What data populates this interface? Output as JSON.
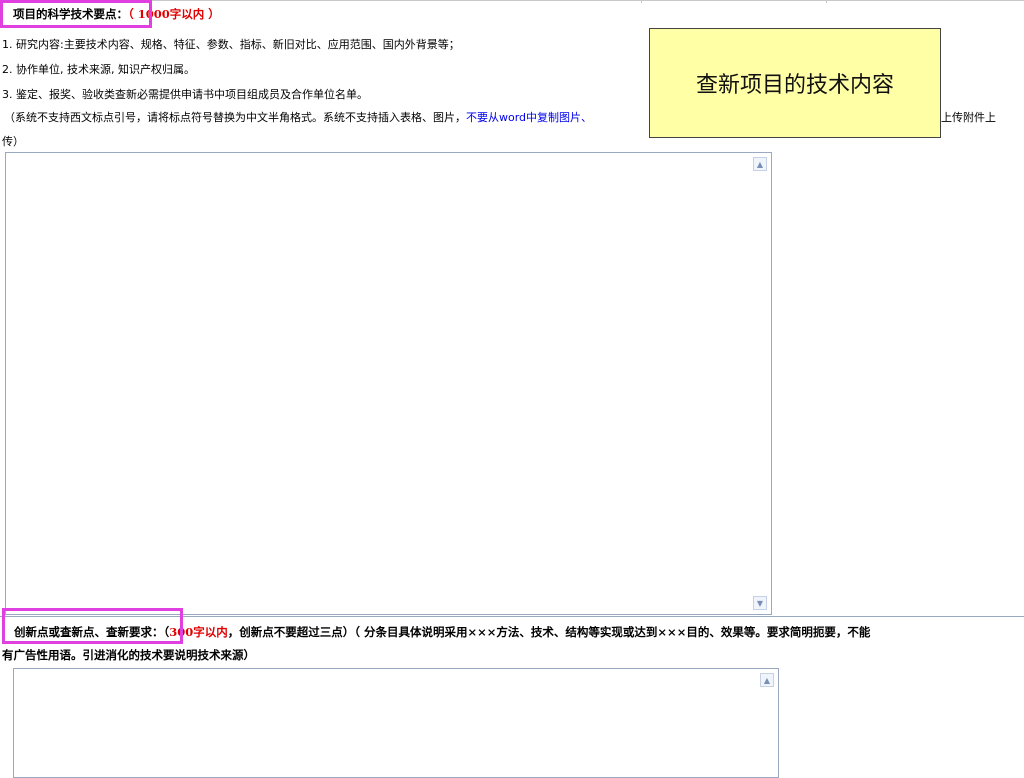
{
  "section1": {
    "title": "项目的科学技术要点：",
    "limit": "（ 1000字以内 ）",
    "items": [
      "1. 研究内容:主要技术内容、规格、特征、参数、指标、新旧对比、应用范围、国内外背景等；",
      "2. 协作单位, 技术来源, 知识产权归属。",
      "3. 鉴定、报奖、验收类查新必需提供申请书中项目组成员及合作单位名单。"
    ],
    "note_prefix": "（系统不支持西文标点引号，请将标点符号替换为中文半角格式。系统不支持插入表格、图片，",
    "note_blue": "不要从word中复制图片、",
    "note_suffix": "上传附件上",
    "note_line2": "传）"
  },
  "tooltip": {
    "text": "查新项目的技术内容",
    "bg": "#ffffa6"
  },
  "section2": {
    "title": "创新点或查新点、查新要求：",
    "limit_open": "（",
    "limit": "300字以内",
    "rest_line1": "，创新点不要超过三点）（ 分条目具体说明采用×××方法、技术、结构等实现或达到×××目的、效果等。要求简明扼要，不能",
    "line2": "有广告性用语。引进消化的技术要说明技术来源）"
  },
  "textarea1": {
    "value": ""
  },
  "textarea2": {
    "value": ""
  },
  "colors": {
    "highlight": "#e040e0",
    "red": "#e00000",
    "blue": "#0000ee"
  },
  "icons": {
    "scroll_up": "chevron-up-icon",
    "scroll_down": "chevron-down-icon"
  }
}
